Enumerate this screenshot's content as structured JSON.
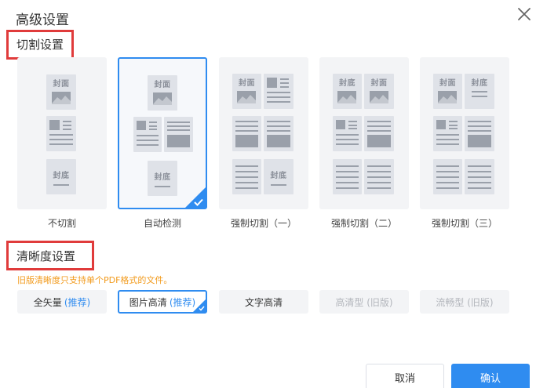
{
  "dialog": {
    "title": "高级设置",
    "close_icon": "close-icon"
  },
  "cut_section": {
    "title": "切割设置",
    "options": [
      {
        "label": "不切割",
        "selected": false
      },
      {
        "label": "自动检测",
        "selected": true
      },
      {
        "label": "强制切割（一）",
        "selected": false
      },
      {
        "label": "强制切割（二）",
        "selected": false
      },
      {
        "label": "强制切割（三）",
        "selected": false
      }
    ],
    "page_labels": {
      "cover": "封面",
      "back": "封底"
    }
  },
  "clarity_section": {
    "title": "清晰度设置",
    "note": "旧版清晰度只支持单个PDF格式的文件。",
    "options": [
      {
        "label": "全矢量",
        "recommend": "(推荐)",
        "selected": false,
        "disabled": false
      },
      {
        "label": "图片高清",
        "recommend": "(推荐)",
        "selected": true,
        "disabled": false
      },
      {
        "label": "文字高清",
        "recommend": "",
        "selected": false,
        "disabled": false
      },
      {
        "label": "高清型 (旧版)",
        "recommend": "",
        "selected": false,
        "disabled": true
      },
      {
        "label": "流畅型 (旧版)",
        "recommend": "",
        "selected": false,
        "disabled": true
      }
    ]
  },
  "footer": {
    "cancel_label": "取消",
    "confirm_label": "确认"
  },
  "colors": {
    "accent": "#2f8cf0",
    "highlight_box": "#e03b3b",
    "note": "#f29a1b"
  }
}
